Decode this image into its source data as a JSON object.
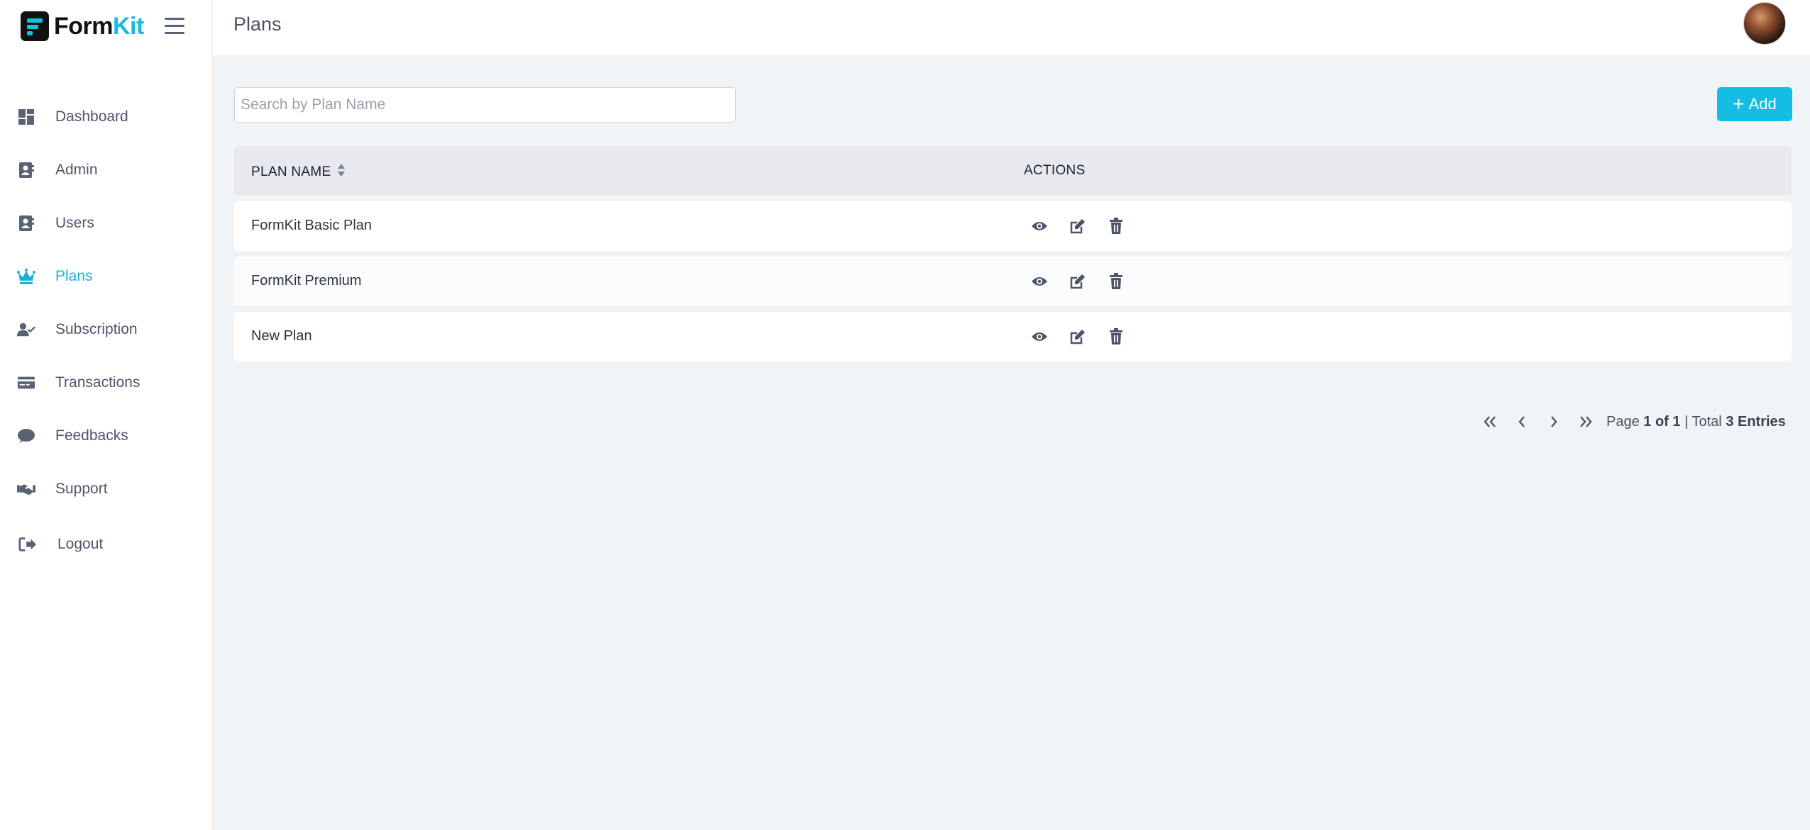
{
  "brand": {
    "form": "Form",
    "kit": "Kit",
    "accent": "#13bde0"
  },
  "header": {
    "title": "Plans"
  },
  "sidebar": {
    "items": [
      {
        "label": "Dashboard",
        "icon": "dashboard-icon"
      },
      {
        "label": "Admin",
        "icon": "contact-book-icon"
      },
      {
        "label": "Users",
        "icon": "contact-book-icon"
      },
      {
        "label": "Plans",
        "icon": "crown-icon",
        "active": true
      },
      {
        "label": "Subscription",
        "icon": "user-check-icon"
      },
      {
        "label": "Transactions",
        "icon": "credit-card-icon"
      },
      {
        "label": "Feedbacks",
        "icon": "comment-icon"
      },
      {
        "label": "Support",
        "icon": "handshake-icon"
      },
      {
        "label": "Logout",
        "icon": "sign-out-icon"
      }
    ]
  },
  "search": {
    "placeholder": "Search by Plan Name",
    "value": ""
  },
  "toolbar": {
    "add_label": "Add"
  },
  "table": {
    "columns": [
      "PLAN NAME",
      "ACTIONS"
    ],
    "rows": [
      {
        "name": "FormKit Basic Plan"
      },
      {
        "name": "FormKit Premium"
      },
      {
        "name": "New Plan"
      }
    ]
  },
  "pagination": {
    "page_label": "Page",
    "page_value": "1 of 1",
    "separator": "|",
    "total_label": "Total",
    "total_value": "3 Entries"
  }
}
